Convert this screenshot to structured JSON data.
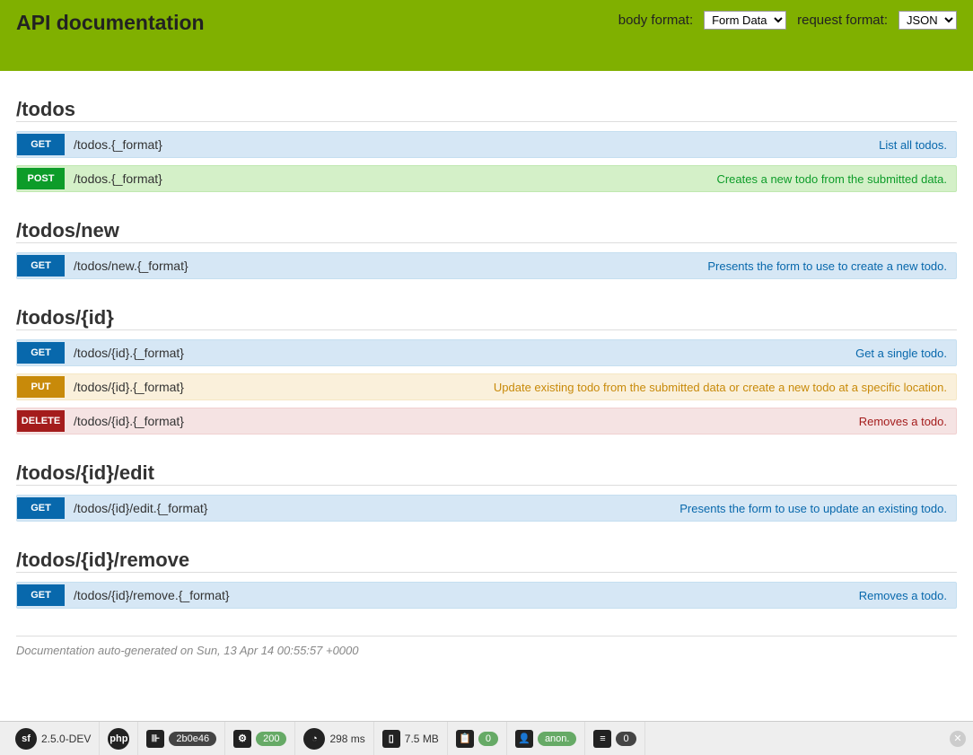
{
  "header": {
    "title": "API documentation",
    "body_format_label": "body format:",
    "body_format_value": "Form Data",
    "request_format_label": "request format:",
    "request_format_value": "JSON"
  },
  "sections": [
    {
      "title": "/todos",
      "endpoints": [
        {
          "method": "GET",
          "class": "get",
          "path": "/todos.{_format}",
          "desc": "List all todos."
        },
        {
          "method": "POST",
          "class": "post",
          "path": "/todos.{_format}",
          "desc": "Creates a new todo from the submitted data."
        }
      ]
    },
    {
      "title": "/todos/new",
      "endpoints": [
        {
          "method": "GET",
          "class": "get",
          "path": "/todos/new.{_format}",
          "desc": "Presents the form to use to create a new todo."
        }
      ]
    },
    {
      "title": "/todos/{id}",
      "endpoints": [
        {
          "method": "GET",
          "class": "get",
          "path": "/todos/{id}.{_format}",
          "desc": "Get a single todo."
        },
        {
          "method": "PUT",
          "class": "put",
          "path": "/todos/{id}.{_format}",
          "desc": "Update existing todo from the submitted data or create a new todo at a specific location."
        },
        {
          "method": "DELETE",
          "class": "delete",
          "path": "/todos/{id}.{_format}",
          "desc": "Removes a todo."
        }
      ]
    },
    {
      "title": "/todos/{id}/edit",
      "endpoints": [
        {
          "method": "GET",
          "class": "get",
          "path": "/todos/{id}/edit.{_format}",
          "desc": "Presents the form to use to update an existing todo."
        }
      ]
    },
    {
      "title": "/todos/{id}/remove",
      "endpoints": [
        {
          "method": "GET",
          "class": "get",
          "path": "/todos/{id}/remove.{_format}",
          "desc": "Removes a todo."
        }
      ]
    }
  ],
  "footer_note": "Documentation auto-generated on Sun, 13 Apr 14 00:55:57 +0000",
  "toolbar": {
    "version": "2.5.0-DEV",
    "token": "2b0e46",
    "status": "200",
    "time": "298 ms",
    "memory": "7.5 MB",
    "forms": "0",
    "user": "anon.",
    "db": "0"
  }
}
